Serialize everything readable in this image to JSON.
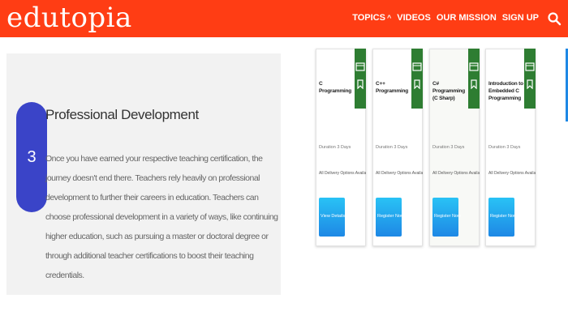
{
  "header": {
    "logo": "edutopia",
    "nav": {
      "topics": "TOPICS",
      "videos": "VIDEOS",
      "mission": "OUR MISSION",
      "signup": "SIGN UP"
    }
  },
  "panel": {
    "step_number": "3",
    "title": "Professional Development",
    "body": "Once you have earned your respective teaching certification, the journey doesn't end there. Teachers rely heavily on professional development to further their careers in education. Teachers can choose professional development in a variety of ways, like continuing higher education, such as pursuing a master or doctoral degree or through additional teacher certifications to boost their teaching credentials."
  },
  "cards": [
    {
      "title": "C Programming",
      "meta1": "Duration 3 Days",
      "meta2": "All Delivery Options Available",
      "button": "View Details"
    },
    {
      "title": "C++ Programming",
      "meta1": "Duration 3 Days",
      "meta2": "All Delivery Options Available",
      "button": "Register Now"
    },
    {
      "title": "C# Programming (C Sharp)",
      "meta1": "Duration 3 Days",
      "meta2": "All Delivery Options Available",
      "button": "Register Now"
    },
    {
      "title": "Introduction to Embedded C Programming",
      "meta1": "Duration 3 Days",
      "meta2": "All Delivery Options Available",
      "button": "Register Now"
    }
  ],
  "colors": {
    "header_bg": "#ff3d14",
    "step_circle": "#3a44c8",
    "card_flag": "#2e7d32",
    "button": "#1e88e5"
  }
}
